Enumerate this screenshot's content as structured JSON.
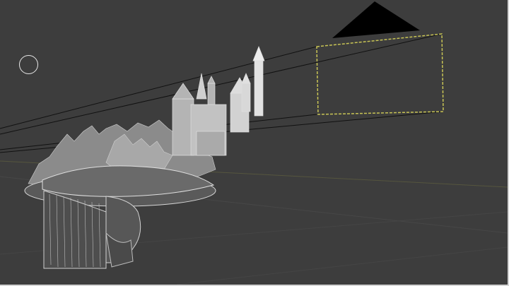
{
  "viewport": {
    "background": "#3d3d3d",
    "frame_color": "#d4d4d4",
    "grid_line_color": "#57573f"
  },
  "camera": {
    "frame_color": "#c8c455",
    "triangle_color": "#000000",
    "ray_color": "#111111"
  },
  "objects": {
    "castle": "castle-sketch-plane",
    "trees": "forest-sketch-plane",
    "portrait": "bearded-man-in-hat-sketch",
    "cursor": "circle-brush-cursor"
  }
}
